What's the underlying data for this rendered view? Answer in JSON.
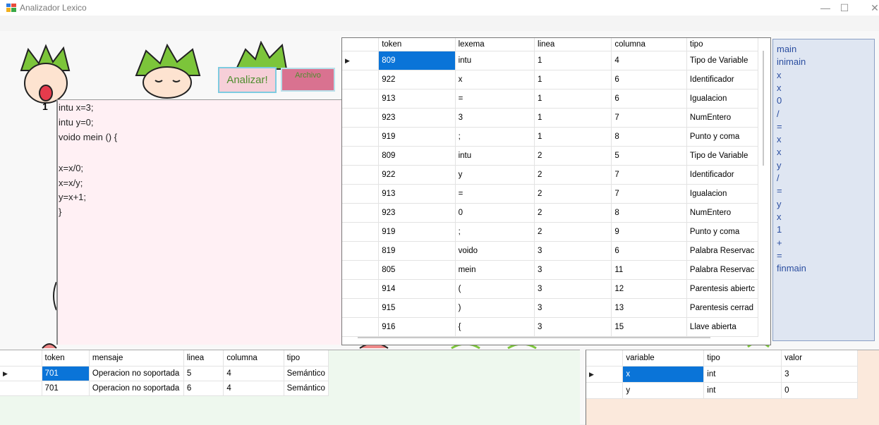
{
  "window": {
    "title": "Analizador Lexico",
    "minimize": "—",
    "maximize": "☐",
    "close": "✕"
  },
  "buttons": {
    "analizar": "Analizar!",
    "archivo": "Archivo"
  },
  "editor": {
    "line_number": "1",
    "lines": [
      "intu x=3;",
      "intu y=0;",
      "voido mein () {",
      "",
      "x=x/0;",
      "x=x/y;",
      "y=x+1;",
      "}"
    ]
  },
  "tokens_table": {
    "headers": [
      "token",
      "lexema",
      "linea",
      "columna",
      "tipo"
    ],
    "rows": [
      [
        "809",
        "intu",
        "1",
        "4",
        "Tipo de Variable"
      ],
      [
        "922",
        "x",
        "1",
        "6",
        "Identificador"
      ],
      [
        "913",
        "=",
        "1",
        "6",
        "Igualacion"
      ],
      [
        "923",
        "3",
        "1",
        "7",
        "NumEntero"
      ],
      [
        "919",
        ";",
        "1",
        "8",
        "Punto y coma"
      ],
      [
        "809",
        "intu",
        "2",
        "5",
        "Tipo de Variable"
      ],
      [
        "922",
        "y",
        "2",
        "7",
        "Identificador"
      ],
      [
        "913",
        "=",
        "2",
        "7",
        "Igualacion"
      ],
      [
        "923",
        "0",
        "2",
        "8",
        "NumEntero"
      ],
      [
        "919",
        ";",
        "2",
        "9",
        "Punto y coma"
      ],
      [
        "819",
        "voido",
        "3",
        "6",
        "Palabra Reservac"
      ],
      [
        "805",
        "mein",
        "3",
        "11",
        "Palabra Reservac"
      ],
      [
        "914",
        "(",
        "3",
        "12",
        "Parentesis abiertc"
      ],
      [
        "915",
        ")",
        "3",
        "13",
        "Parentesis cerrad"
      ],
      [
        "916",
        "{",
        "3",
        "15",
        "Llave abierta"
      ]
    ]
  },
  "postfix_list": [
    "main",
    "inimain",
    "x",
    "x",
    "0",
    "/",
    "=",
    "x",
    "x",
    "y",
    "/",
    "=",
    "y",
    "x",
    "1",
    "+",
    "=",
    "finmain"
  ],
  "errors_table": {
    "headers": [
      "token",
      "mensaje",
      "linea",
      "columna",
      "tipo"
    ],
    "rows": [
      [
        "701",
        "Operacion no soportada",
        "5",
        "4",
        "Semántico"
      ],
      [
        "701",
        "Operacion no soportada",
        "6",
        "4",
        "Semántico"
      ]
    ]
  },
  "symbols_table": {
    "headers": [
      "variable",
      "tipo",
      "valor"
    ],
    "rows": [
      [
        "x",
        "int",
        "3"
      ],
      [
        "y",
        "int",
        "0"
      ]
    ]
  },
  "colors": {
    "selection": "#0a74d8",
    "editor_bg": "#fff0f4",
    "list_bg": "#dfe6f2",
    "list_text": "#2b4ea0"
  },
  "icons": [
    "app-icon",
    "row-pointer-icon",
    "cartoon-character-decoration"
  ]
}
